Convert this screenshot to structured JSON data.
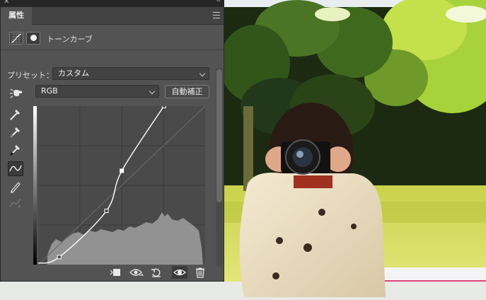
{
  "panel": {
    "tab_label": "属性",
    "adjustment_title": "トーンカーブ",
    "preset_label": "プリセット：",
    "preset_value": "カスタム",
    "channel_value": "RGB",
    "auto_button": "自動補正",
    "scroll_position": 0.0
  },
  "curve": {
    "points": [
      [
        0,
        0
      ],
      [
        33,
        10
      ],
      [
        107,
        85
      ],
      [
        131,
        150
      ],
      [
        197,
        255
      ]
    ],
    "input_range": [
      0,
      255
    ],
    "output_range": [
      0,
      255
    ]
  },
  "colors": {
    "panel_bg": "#535353",
    "accent": "#ffffff"
  },
  "icons": [
    "close-icon",
    "collapse-icon",
    "panel-menu-icon",
    "curves-icon",
    "mask-icon",
    "on-image-adjust-icon",
    "white-point-eyedropper-icon",
    "gray-point-eyedropper-icon",
    "black-point-eyedropper-icon",
    "point-curve-icon",
    "pencil-icon",
    "smooth-icon",
    "clip-to-layer-icon",
    "view-previous-icon",
    "reset-icon",
    "visibility-icon",
    "trash-icon"
  ]
}
